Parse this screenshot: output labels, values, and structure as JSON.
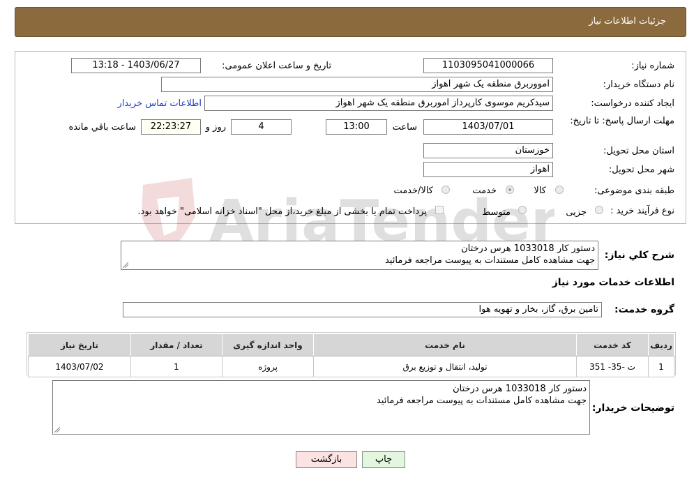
{
  "header": {
    "title": "جزئیات اطلاعات نیاز"
  },
  "form": {
    "need_number": {
      "label": "شماره نیاز:",
      "value": "1103095041000066"
    },
    "announce_datetime": {
      "label": "تاریخ و ساعت اعلان عمومی:",
      "value": "1403/06/27 - 13:18"
    },
    "buyer_org": {
      "label": "نام دستگاه خریدار:",
      "value": "امووربرق منطقه یک شهر اهواز"
    },
    "requester": {
      "label": "ایجاد کننده درخواست:",
      "value": "سیدکریم موسوی کارپرداز اموربرق منطقه یک شهر اهواز",
      "contact_link": "اطلاعات تماس خریدار"
    },
    "deadline": {
      "label": "مهلت ارسال پاسخ: تا تاریخ:",
      "date": "1403/07/01",
      "time_label": "ساعت",
      "time": "13:00",
      "days": "4",
      "days_label": "روز و",
      "remaining": "22:23:27",
      "remaining_label": "ساعت باقي مانده"
    },
    "province": {
      "label": "استان محل تحویل:",
      "value": "خوزستان"
    },
    "city": {
      "label": "شهر محل تحویل:",
      "value": "اهواز"
    },
    "category": {
      "label": "طبقه بندی موضوعی:",
      "options": [
        {
          "label": "کالا",
          "selected": false
        },
        {
          "label": "خدمت",
          "selected": true
        },
        {
          "label": "کالا/خدمت",
          "selected": false
        }
      ]
    },
    "purchase_process": {
      "label": "نوع فرآیند خرید :",
      "options": [
        {
          "label": "جزیی",
          "selected": false
        },
        {
          "label": "متوسط",
          "selected": false
        }
      ],
      "payment_note": "پرداخت تمام یا بخشی از مبلغ خرید،از محل \"اسناد خزانه اسلامی\" خواهد بود."
    }
  },
  "summary": {
    "label": "شرح کلي نياز:",
    "line1": "دستور کار 1033018 هرس درختان",
    "line2": "جهت مشاهده کامل مستندات به پیوست مراجعه فرمائید"
  },
  "services_section": {
    "title": "اطلاعات خدمات مورد نياز",
    "group_label": "گروه خدمت:",
    "group_value": "تامین برق، گاز، بخار و تهویه هوا"
  },
  "table": {
    "headers": [
      "ردیف",
      "کد خدمت",
      "نام خدمت",
      "واحد اندازه گیری",
      "تعداد / مقدار",
      "تاریخ نیاز"
    ],
    "rows": [
      [
        "1",
        "ت -35- 351",
        "تولید، انتقال و توزیع برق",
        "پروژه",
        "1",
        "1403/07/02"
      ]
    ]
  },
  "buyer_notes": {
    "label": "توضیحات خریدار:",
    "line1": "دستور کار 1033018 هرس درختان",
    "line2": "جهت مشاهده کامل مستندات به پیوست مراجعه فرمائید"
  },
  "buttons": {
    "print": "چاپ",
    "back": "بازگشت"
  },
  "watermark": {
    "text": "AriaTender.neT"
  },
  "colors": {
    "header_bg": "#8b6a3e",
    "link": "#1a3cc9",
    "back_button_bg": "#fbe3e3",
    "print_button_bg": "#e3f7df"
  }
}
